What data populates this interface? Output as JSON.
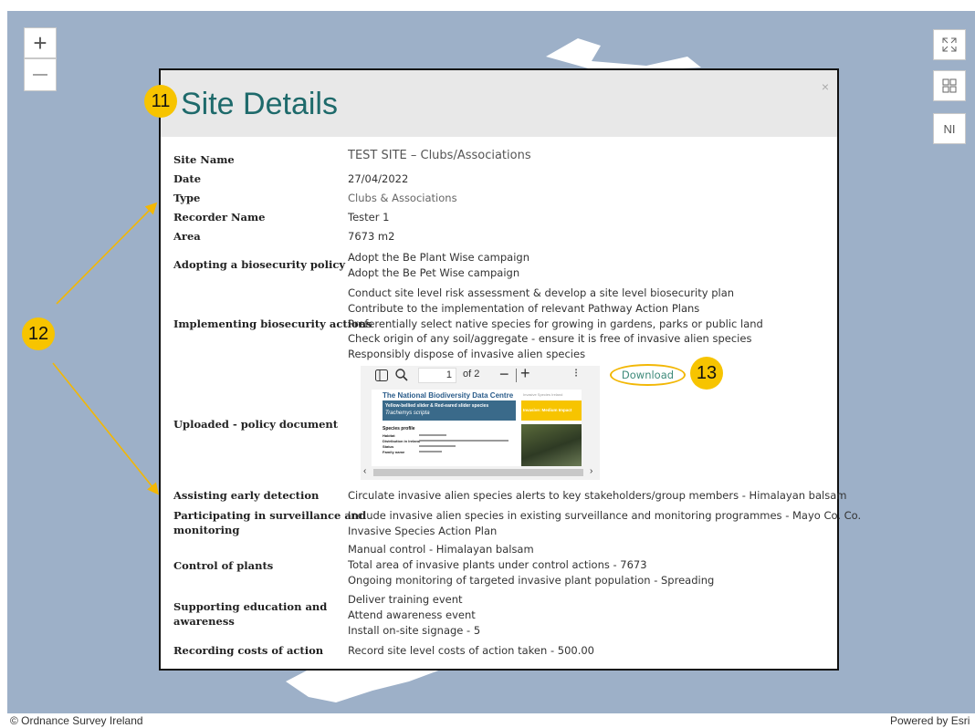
{
  "map": {
    "zoom_in": "+",
    "zoom_out": "—",
    "ni_label": "NI",
    "attribution_left": "© Ordnance Survey Ireland",
    "attribution_right": "Powered by Esri"
  },
  "modal": {
    "title": "Site Details",
    "close": "×",
    "rows": [
      {
        "label": "Site Name",
        "values": [
          "TEST SITE – Clubs/Associations"
        ]
      },
      {
        "label": "Date",
        "values": [
          "27/04/2022"
        ]
      },
      {
        "label": "Type",
        "values": [
          "Clubs & Associations"
        ]
      },
      {
        "label": "Recorder Name",
        "values": [
          "Tester 1"
        ]
      },
      {
        "label": "Area",
        "values": [
          "7673 m2"
        ]
      },
      {
        "label": "Adopting a biosecurity policy",
        "values": [
          "Adopt the Be Plant Wise campaign",
          "Adopt the Be Pet Wise campaign"
        ]
      },
      {
        "label": "Implementing biosecurity actions",
        "values": [
          "Conduct site level risk assessment & develop a site level biosecurity plan",
          "Contribute to the implementation of relevant Pathway Action Plans",
          "Preferentially select native species for growing in gardens, parks or public land",
          "Check origin of any soil/aggregate - ensure it is free of invasive alien species",
          "Responsibly dispose of invasive alien species"
        ]
      },
      {
        "label": "Uploaded - policy document",
        "values": []
      },
      {
        "label": "Assisting early detection",
        "values": [
          "Circulate invasive alien species alerts to key stakeholders/group members - Himalayan balsam"
        ]
      },
      {
        "label": "Participating in surveillance and",
        "label2": "monitoring",
        "values": [
          "Include invasive alien species in existing surveillance and monitoring programmes - Mayo Co. Co.",
          "Invasive Species Action Plan"
        ]
      },
      {
        "label": "Control of plants",
        "values": [
          "Manual control - Himalayan balsam",
          "Total area of invasive plants under control actions - 7673",
          "Ongoing monitoring of targeted invasive plant population - Spreading"
        ]
      },
      {
        "label": "Supporting education and",
        "label2": "awareness",
        "values": [
          "Deliver training event",
          "Attend awareness event",
          "Install on-site signage - 5"
        ]
      },
      {
        "label": "Recording costs of action",
        "values": [
          "Record site level costs of action taken - 500.00"
        ]
      }
    ]
  },
  "pdf_viewer": {
    "page_input": "1",
    "page_of": "of 2",
    "download": "Download",
    "doc_header": "The National Biodiversity Data Centre",
    "doc_header_right": "Invasive Species Ireland",
    "species_title": "Yellow-bellied slider & Red-eared slider species",
    "species_latin": "Trachemys scripta",
    "impact_label": "Invasive: Medium Impact",
    "profile_heading": "Species profile",
    "profile_keys": [
      "Habitat",
      "Distribution in Ireland",
      "Status",
      "Family name"
    ]
  },
  "annotations": {
    "badge_11": "11",
    "badge_12": "12",
    "badge_13": "13",
    "accent": "#f7c400"
  }
}
